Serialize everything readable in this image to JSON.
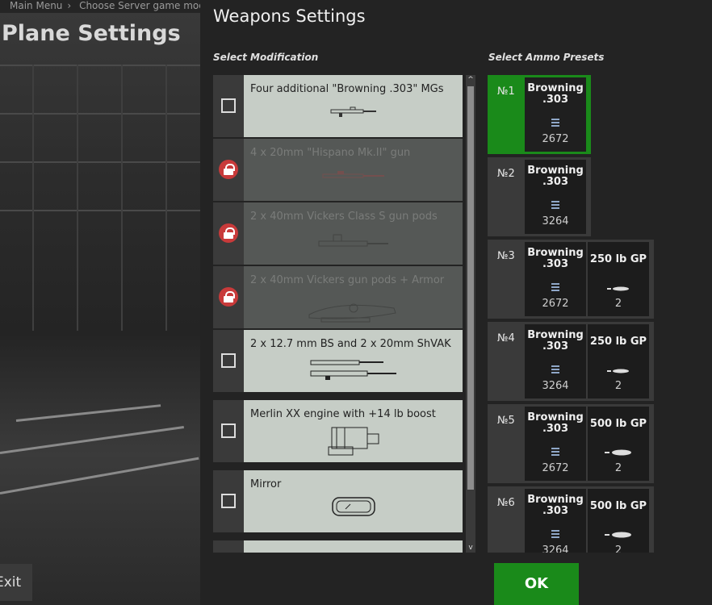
{
  "breadcrumb": [
    "Main Menu",
    "Choose Server game mod"
  ],
  "plane_title": "Plane Settings",
  "exit_label": "Exit",
  "dialog": {
    "title": "Weapons Settings",
    "mod_label": "Select Modification",
    "ammo_label": "Select Ammo Presets",
    "ok_label": "OK"
  },
  "modifications": [
    {
      "name": "Four additional \"Browning .303\" MGs",
      "locked": false,
      "checked": false,
      "icon": "machine-gun-icon"
    },
    {
      "name": "4 x 20mm \"Hispano Mk.II\" gun",
      "locked": true,
      "checked": false,
      "icon": "cannon-icon"
    },
    {
      "name": "2 x 40mm Vickers Class S gun pods",
      "locked": true,
      "checked": false,
      "icon": "gun-pod-icon"
    },
    {
      "name": "2 x 40mm Vickers gun pods + Armor",
      "locked": true,
      "checked": false,
      "icon": "gun-pod-armor-icon"
    },
    {
      "name": "2 x 12.7 mm BS and 2 x 20mm ShVAK",
      "locked": false,
      "checked": false,
      "icon": "twin-guns-icon"
    },
    {
      "name": "Merlin XX engine with +14 lb boost",
      "locked": false,
      "checked": false,
      "icon": "engine-icon"
    },
    {
      "name": "Mirror",
      "locked": false,
      "checked": false,
      "icon": "mirror-icon"
    },
    {
      "name": "",
      "locked": false,
      "checked": false,
      "icon": ""
    }
  ],
  "presets": [
    {
      "num": "№1",
      "active": true,
      "slots": [
        {
          "name": "Browning .303",
          "count": "2672",
          "icon": "ammo-belt-icon"
        }
      ]
    },
    {
      "num": "№2",
      "active": false,
      "slots": [
        {
          "name": "Browning .303",
          "count": "3264",
          "icon": "ammo-belt-icon"
        }
      ]
    },
    {
      "num": "№3",
      "active": false,
      "slots": [
        {
          "name": "Browning .303",
          "count": "2672",
          "icon": "ammo-belt-icon"
        },
        {
          "name": "250 lb GP",
          "count": "2",
          "icon": "bomb-icon"
        }
      ]
    },
    {
      "num": "№4",
      "active": false,
      "slots": [
        {
          "name": "Browning .303",
          "count": "3264",
          "icon": "ammo-belt-icon"
        },
        {
          "name": "250 lb GP",
          "count": "2",
          "icon": "bomb-icon"
        }
      ]
    },
    {
      "num": "№5",
      "active": false,
      "slots": [
        {
          "name": "Browning .303",
          "count": "2672",
          "icon": "ammo-belt-icon"
        },
        {
          "name": "500 lb GP",
          "count": "2",
          "icon": "bomb-icon"
        }
      ]
    },
    {
      "num": "№6",
      "active": false,
      "slots": [
        {
          "name": "Browning .303",
          "count": "3264",
          "icon": "ammo-belt-icon"
        },
        {
          "name": "500 lb GP",
          "count": "2",
          "icon": "bomb-icon"
        }
      ]
    }
  ],
  "colors": {
    "accent": "#1a8a1a",
    "lock": "#c83a3a"
  }
}
